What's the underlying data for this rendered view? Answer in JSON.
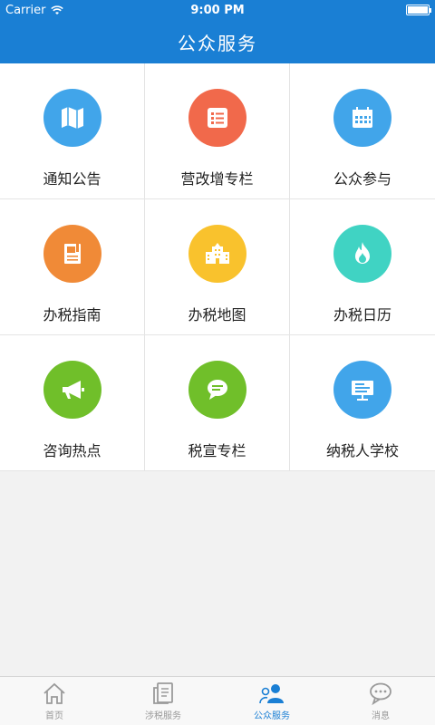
{
  "status": {
    "carrier": "Carrier",
    "time": "9:00 PM"
  },
  "header": {
    "title": "公众服务"
  },
  "colors": {
    "accent": "#1a7fd4",
    "blue": "#41a5ea",
    "orange": "#f08a37",
    "red": "#f1694b",
    "yellow": "#f9c22d",
    "teal": "#40d3c3",
    "green": "#70bf2a"
  },
  "grid": [
    {
      "label": "通知公告",
      "icon": "map-icon",
      "color": "#41a5ea"
    },
    {
      "label": "营改增专栏",
      "icon": "list-icon",
      "color": "#f1694b"
    },
    {
      "label": "公众参与",
      "icon": "calendar-icon",
      "color": "#41a5ea"
    },
    {
      "label": "办税指南",
      "icon": "book-icon",
      "color": "#f08a37"
    },
    {
      "label": "办税地图",
      "icon": "building-icon",
      "color": "#f9c22d"
    },
    {
      "label": "办税日历",
      "icon": "flame-icon",
      "color": "#40d3c3"
    },
    {
      "label": "咨询热点",
      "icon": "megaphone-icon",
      "color": "#70bf2a"
    },
    {
      "label": "税宣专栏",
      "icon": "chat-icon",
      "color": "#70bf2a"
    },
    {
      "label": "纳税人学校",
      "icon": "presentation-icon",
      "color": "#41a5ea"
    }
  ],
  "tabs": [
    {
      "label": "首页",
      "icon": "home-icon",
      "active": false
    },
    {
      "label": "涉税服务",
      "icon": "document-icon",
      "active": false
    },
    {
      "label": "公众服务",
      "icon": "people-icon",
      "active": true
    },
    {
      "label": "消息",
      "icon": "message-icon",
      "active": false
    }
  ]
}
